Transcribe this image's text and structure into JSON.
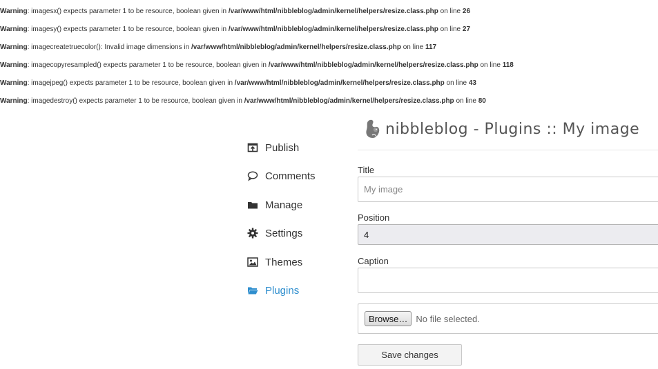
{
  "warnings": [
    {
      "label": "Warning",
      "message": ": imagesx() expects parameter 1 to be resource, boolean given in ",
      "file": "/var/www/html/nibbleblog/admin/kernel/helpers/resize.class.php",
      "on_line_text": " on line ",
      "line": "26"
    },
    {
      "label": "Warning",
      "message": ": imagesy() expects parameter 1 to be resource, boolean given in ",
      "file": "/var/www/html/nibbleblog/admin/kernel/helpers/resize.class.php",
      "on_line_text": " on line ",
      "line": "27"
    },
    {
      "label": "Warning",
      "message": ": imagecreatetruecolor(): Invalid image dimensions in ",
      "file": "/var/www/html/nibbleblog/admin/kernel/helpers/resize.class.php",
      "on_line_text": " on line ",
      "line": "117"
    },
    {
      "label": "Warning",
      "message": ": imagecopyresampled() expects parameter 1 to be resource, boolean given in ",
      "file": "/var/www/html/nibbleblog/admin/kernel/helpers/resize.class.php",
      "on_line_text": " on line ",
      "line": "118"
    },
    {
      "label": "Warning",
      "message": ": imagejpeg() expects parameter 1 to be resource, boolean given in ",
      "file": "/var/www/html/nibbleblog/admin/kernel/helpers/resize.class.php",
      "on_line_text": " on line ",
      "line": "43"
    },
    {
      "label": "Warning",
      "message": ": imagedestroy() expects parameter 1 to be resource, boolean given in ",
      "file": "/var/www/html/nibbleblog/admin/kernel/helpers/resize.class.php",
      "on_line_text": " on line ",
      "line": "80"
    }
  ],
  "header": {
    "title": "nibbleblog - Plugins :: My image",
    "logo_icon": "squirrel-logo-icon"
  },
  "sidebar": {
    "items": [
      {
        "label": "Publish",
        "icon": "publish-icon",
        "active": false
      },
      {
        "label": "Comments",
        "icon": "comment-icon",
        "active": false
      },
      {
        "label": "Manage",
        "icon": "folder-icon",
        "active": false
      },
      {
        "label": "Settings",
        "icon": "gear-icon",
        "active": false
      },
      {
        "label": "Themes",
        "icon": "image-icon",
        "active": false
      },
      {
        "label": "Plugins",
        "icon": "folder-open-icon",
        "active": true
      }
    ],
    "active_color": "#2e8ece"
  },
  "form": {
    "title_label": "Title",
    "title_placeholder": "My image",
    "title_value": "",
    "position_label": "Position",
    "position_value": "4",
    "caption_label": "Caption",
    "caption_value": "",
    "browse_label": "Browse…",
    "file_status": "No file selected.",
    "save_label": "Save changes"
  }
}
